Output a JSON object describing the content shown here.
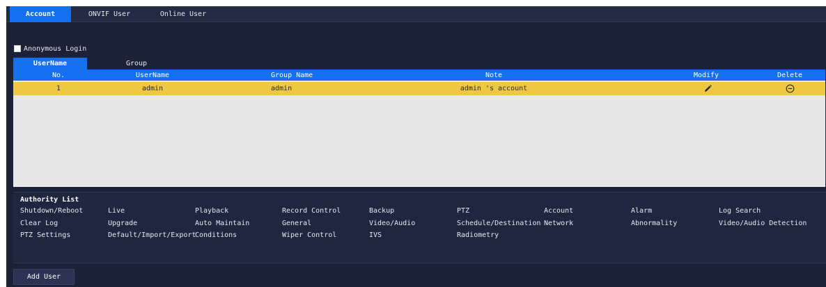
{
  "top_tabs": [
    "Account",
    "ONVIF User",
    "Online User"
  ],
  "anonymous_login": {
    "label": "Anonymous Login",
    "checked": true
  },
  "sub_tabs": [
    "UserName",
    "Group"
  ],
  "table": {
    "headers": [
      "No.",
      "UserName",
      "Group Name",
      "Note",
      "Modify",
      "Delete"
    ],
    "rows": [
      {
        "no": "1",
        "username": "admin",
        "group": "admin",
        "note": "admin 's account",
        "modify_icon": "pencil-icon",
        "delete_icon": "minus-circle-icon"
      }
    ]
  },
  "authority": {
    "title": "Authority List",
    "rows": [
      [
        "Shutdown/Reboot",
        "Live",
        "Playback",
        "Record Control",
        "Backup",
        "PTZ",
        "Account",
        "Alarm",
        "Log Search"
      ],
      [
        "Clear Log",
        "Upgrade",
        "Auto Maintain",
        "General",
        "Video/Audio",
        "Schedule/Destination",
        "Network",
        "Abnormality",
        "Video/Audio Detection"
      ],
      [
        "PTZ Settings",
        "Default/Import/Export",
        "Conditions",
        "Wiper Control",
        "IVS",
        "Radiometry"
      ]
    ]
  },
  "add_user_label": "Add User",
  "colors": {
    "background": "#1b2238",
    "accent": "#1570f0",
    "selected_row": "#eec843",
    "table_body": "#e8e8e8"
  }
}
